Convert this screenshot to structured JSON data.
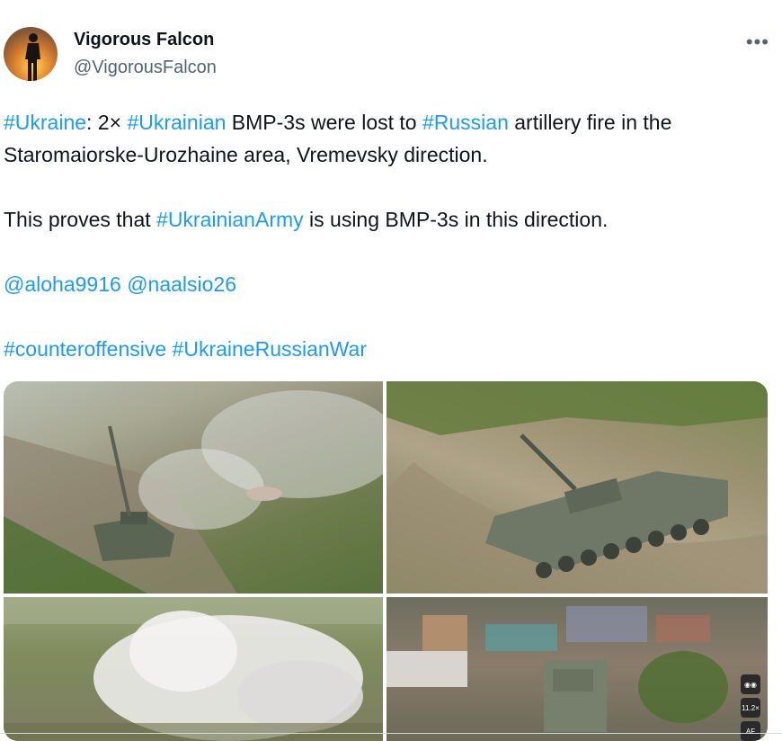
{
  "author": {
    "name": "Vigorous Falcon",
    "handle": "@VigorousFalcon",
    "avatar_icon": "silhouette-sunset-avatar"
  },
  "more_label": "•••",
  "tweet": {
    "line1": {
      "tag_ukraine": "#Ukraine",
      "t1": ": 2× ",
      "tag_ukrainian": "#Ukrainian",
      "t2": " BMP-3s were lost to ",
      "tag_russian": "#Russian",
      "t3": " artillery fire in the Staromaiorske-Urozhaine area, Vremevsky direction."
    },
    "line2": {
      "t1": "This proves that ",
      "tag_army": "#UkrainianArmy",
      "t2": " is using BMP-3s in this direction."
    },
    "mentions": [
      "@aloha9916",
      "@naalsio26"
    ],
    "hashtags": [
      "#counteroffensive",
      "#UkraineRussianWar"
    ]
  },
  "media": {
    "overlay": {
      "binoculars_icon": "binoculars-icon",
      "zoom_text": "11.2×",
      "af_text": "AF"
    }
  },
  "colors": {
    "link": "#1d9bf0",
    "text": "#0f1419",
    "secondary": "#536471"
  }
}
